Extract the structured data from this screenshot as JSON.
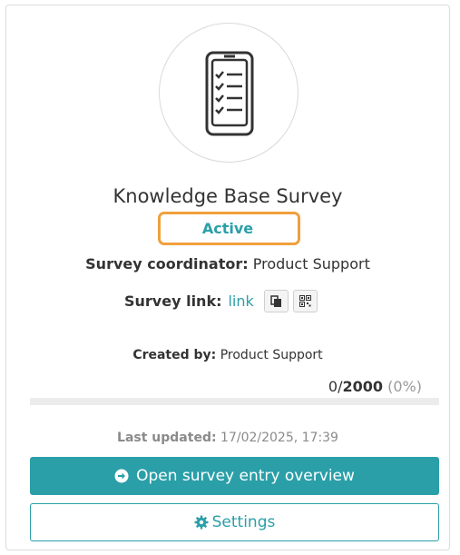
{
  "survey": {
    "title": "Knowledge Base Survey",
    "status": "Active",
    "coordinator_label": "Survey coordinator:",
    "coordinator_value": "Product Support",
    "link_label": "Survey link:",
    "link_text": "link",
    "created_label": "Created by:",
    "created_value": "Product Support",
    "progress_count": "0",
    "progress_total": "2000",
    "progress_percent": "(0%)",
    "progress_fraction": 0,
    "updated_label": "Last updated:",
    "updated_value": "17/02/2025, 17:39"
  },
  "actions": {
    "open_overview": "Open survey entry overview",
    "settings": "Settings"
  },
  "icons": {
    "survey": "clipboard-checklist-icon",
    "copy": "copy-icon",
    "qr": "qr-code-icon",
    "open": "arrow-circle-right-icon",
    "settings": "gear-icon"
  },
  "colors": {
    "accent": "#2a9fa8",
    "status_highlight": "#f0a03c"
  }
}
